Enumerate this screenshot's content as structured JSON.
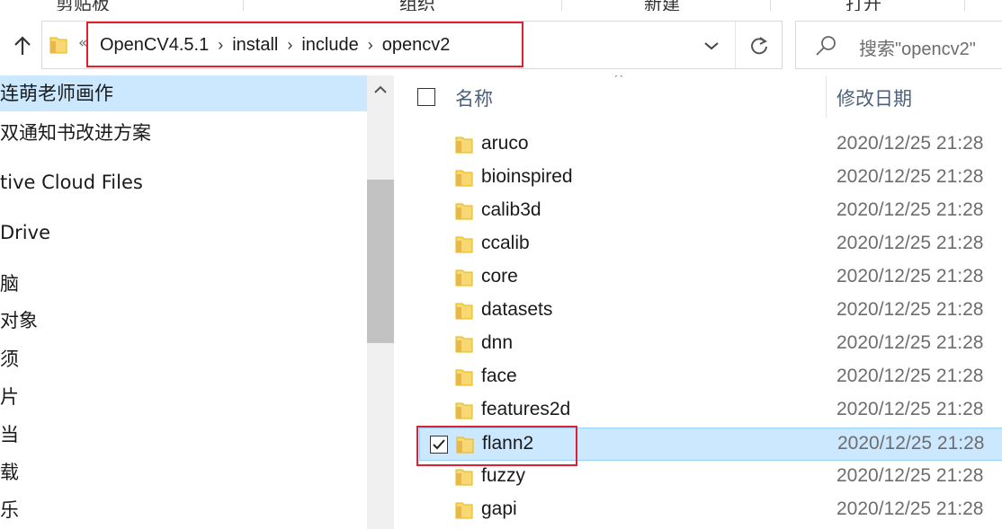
{
  "ribbon": {
    "groups": [
      "剪贴板",
      "组织",
      "新建",
      "打开"
    ]
  },
  "address_bar": {
    "overflow_chevron": "«",
    "crumbs": [
      "OpenCV4.5.1",
      "install",
      "include",
      "opencv2"
    ],
    "separator": "›"
  },
  "search": {
    "placeholder": "搜索\"opencv2\""
  },
  "nav_pane": {
    "items": [
      {
        "label": "连萌老师画作",
        "selected": true
      },
      {
        "label": "双通知书改进方案",
        "selected": false
      },
      {
        "label": "tive Cloud Files",
        "selected": false
      },
      {
        "label": "Drive",
        "selected": false
      },
      {
        "label": "脑",
        "selected": false
      },
      {
        "label": " 对象",
        "selected": false
      },
      {
        "label": "须",
        "selected": false
      },
      {
        "label": "片",
        "selected": false
      },
      {
        "label": "当",
        "selected": false
      },
      {
        "label": "载",
        "selected": false
      },
      {
        "label": "乐",
        "selected": false
      }
    ]
  },
  "file_list": {
    "columns": {
      "name": "名称",
      "date": "修改日期"
    },
    "rows": [
      {
        "name": "aruco",
        "date": "2020/12/25 21:28",
        "selected": false
      },
      {
        "name": "bioinspired",
        "date": "2020/12/25 21:28",
        "selected": false
      },
      {
        "name": "calib3d",
        "date": "2020/12/25 21:28",
        "selected": false
      },
      {
        "name": "ccalib",
        "date": "2020/12/25 21:28",
        "selected": false
      },
      {
        "name": "core",
        "date": "2020/12/25 21:28",
        "selected": false
      },
      {
        "name": "datasets",
        "date": "2020/12/25 21:28",
        "selected": false
      },
      {
        "name": "dnn",
        "date": "2020/12/25 21:28",
        "selected": false
      },
      {
        "name": "face",
        "date": "2020/12/25 21:28",
        "selected": false
      },
      {
        "name": "features2d",
        "date": "2020/12/25 21:28",
        "selected": false
      },
      {
        "name": "flann2",
        "date": "2020/12/25 21:28",
        "selected": true
      },
      {
        "name": "fuzzy",
        "date": "2020/12/25 21:28",
        "selected": false
      },
      {
        "name": "gapi",
        "date": "2020/12/25 21:28",
        "selected": false
      }
    ]
  },
  "colors": {
    "selection": "#cce8ff",
    "highlight_box": "#e02030",
    "folder": "#f8d775"
  }
}
